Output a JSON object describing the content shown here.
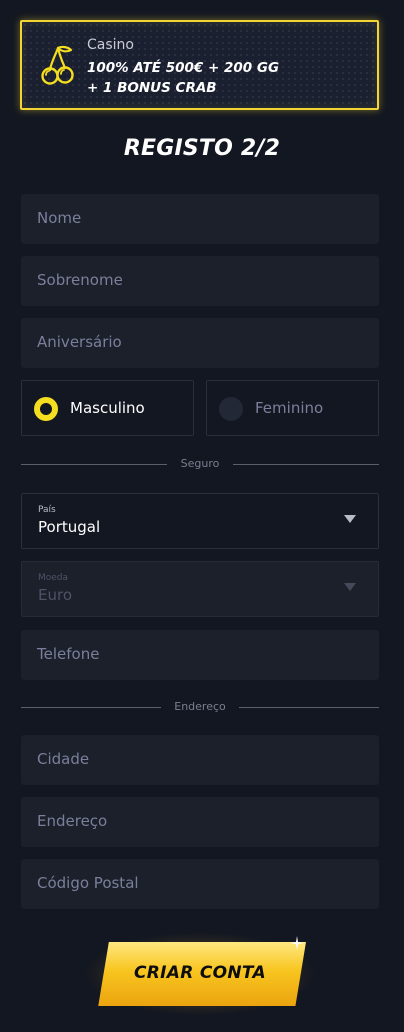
{
  "promo": {
    "category": "Casino",
    "line1": "100% ATÉ 500€ + 200 GG",
    "line2": "+ 1 BONUS CRAB",
    "icon": "cherries-icon"
  },
  "form": {
    "title": "REGISTO 2/2",
    "first_name_placeholder": "Nome",
    "last_name_placeholder": "Sobrenome",
    "birthday_placeholder": "Aniversário",
    "gender": {
      "male_label": "Masculino",
      "female_label": "Feminino",
      "selected": "Masculino"
    },
    "security_divider": "Seguro",
    "country": {
      "label": "País",
      "value": "Portugal"
    },
    "currency": {
      "label": "Moeda",
      "value": "Euro",
      "disabled": true
    },
    "phone_placeholder": "Telefone",
    "address_divider": "Endereço",
    "city_placeholder": "Cidade",
    "address_placeholder": "Endereço",
    "postal_code_placeholder": "Código Postal",
    "submit_label": "CRIAR CONTA"
  },
  "colors": {
    "background": "#131721",
    "field": "#1b202b",
    "accent": "#f5dd1f",
    "placeholder": "#7b7f9b"
  }
}
